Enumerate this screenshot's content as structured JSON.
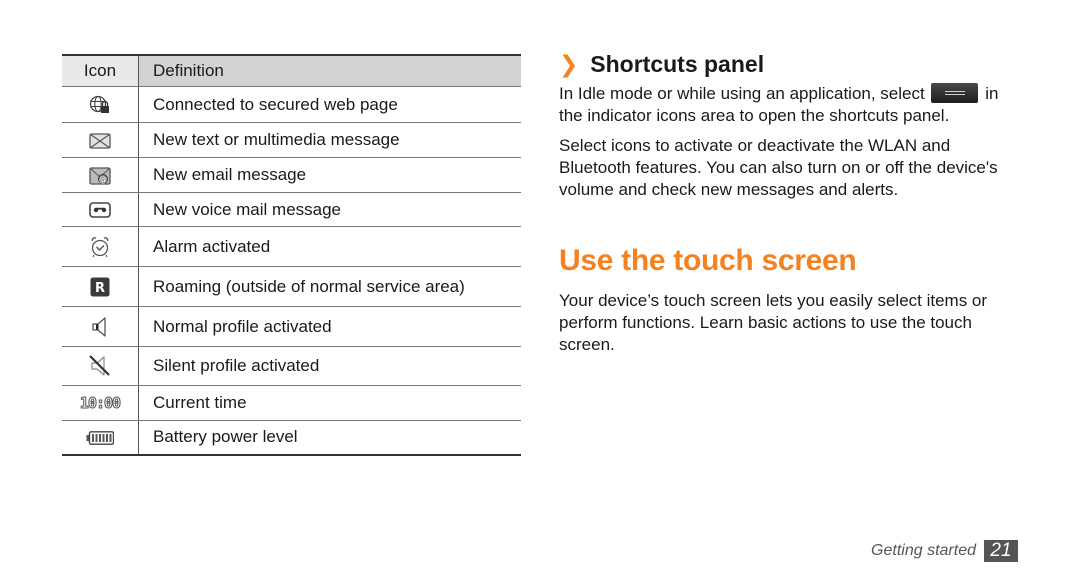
{
  "table": {
    "headers": {
      "icon": "Icon",
      "definition": "Definition"
    },
    "rows": [
      {
        "icon": "secured-web-globe-icon",
        "definition": "Connected to secured web page"
      },
      {
        "icon": "envelope-icon",
        "definition": "New text or multimedia message"
      },
      {
        "icon": "email-at-envelope-icon",
        "definition": "New email message"
      },
      {
        "icon": "voicemail-icon",
        "definition": "New voice mail message"
      },
      {
        "icon": "alarm-clock-icon",
        "definition": "Alarm activated"
      },
      {
        "icon": "roaming-r-icon",
        "definition": "Roaming (outside of normal service area)"
      },
      {
        "icon": "speaker-icon",
        "definition": "Normal profile activated"
      },
      {
        "icon": "speaker-muted-icon",
        "definition": "Silent profile activated"
      },
      {
        "icon": "clock-digits-icon",
        "definition": "Current time",
        "icon_text": "10:00"
      },
      {
        "icon": "battery-icon",
        "definition": "Battery power level"
      }
    ]
  },
  "shortcuts": {
    "chevron": "❯",
    "heading": "Shortcuts panel",
    "para1_before": "In Idle mode or while using an application, select",
    "para1_after": "in the indicator icons area to open the shortcuts panel.",
    "para2": "Select icons to activate or deactivate the WLAN and Bluetooth features. You can also turn on or off the device's volume and check new messages and alerts."
  },
  "touch": {
    "title": "Use the touch screen",
    "para": "Your device’s touch screen lets you easily select items or perform functions. Learn basic actions to use the touch screen."
  },
  "footer": {
    "section": "Getting started",
    "page": "21"
  },
  "colors": {
    "accent": "#f58220",
    "page_badge": "#555555"
  }
}
